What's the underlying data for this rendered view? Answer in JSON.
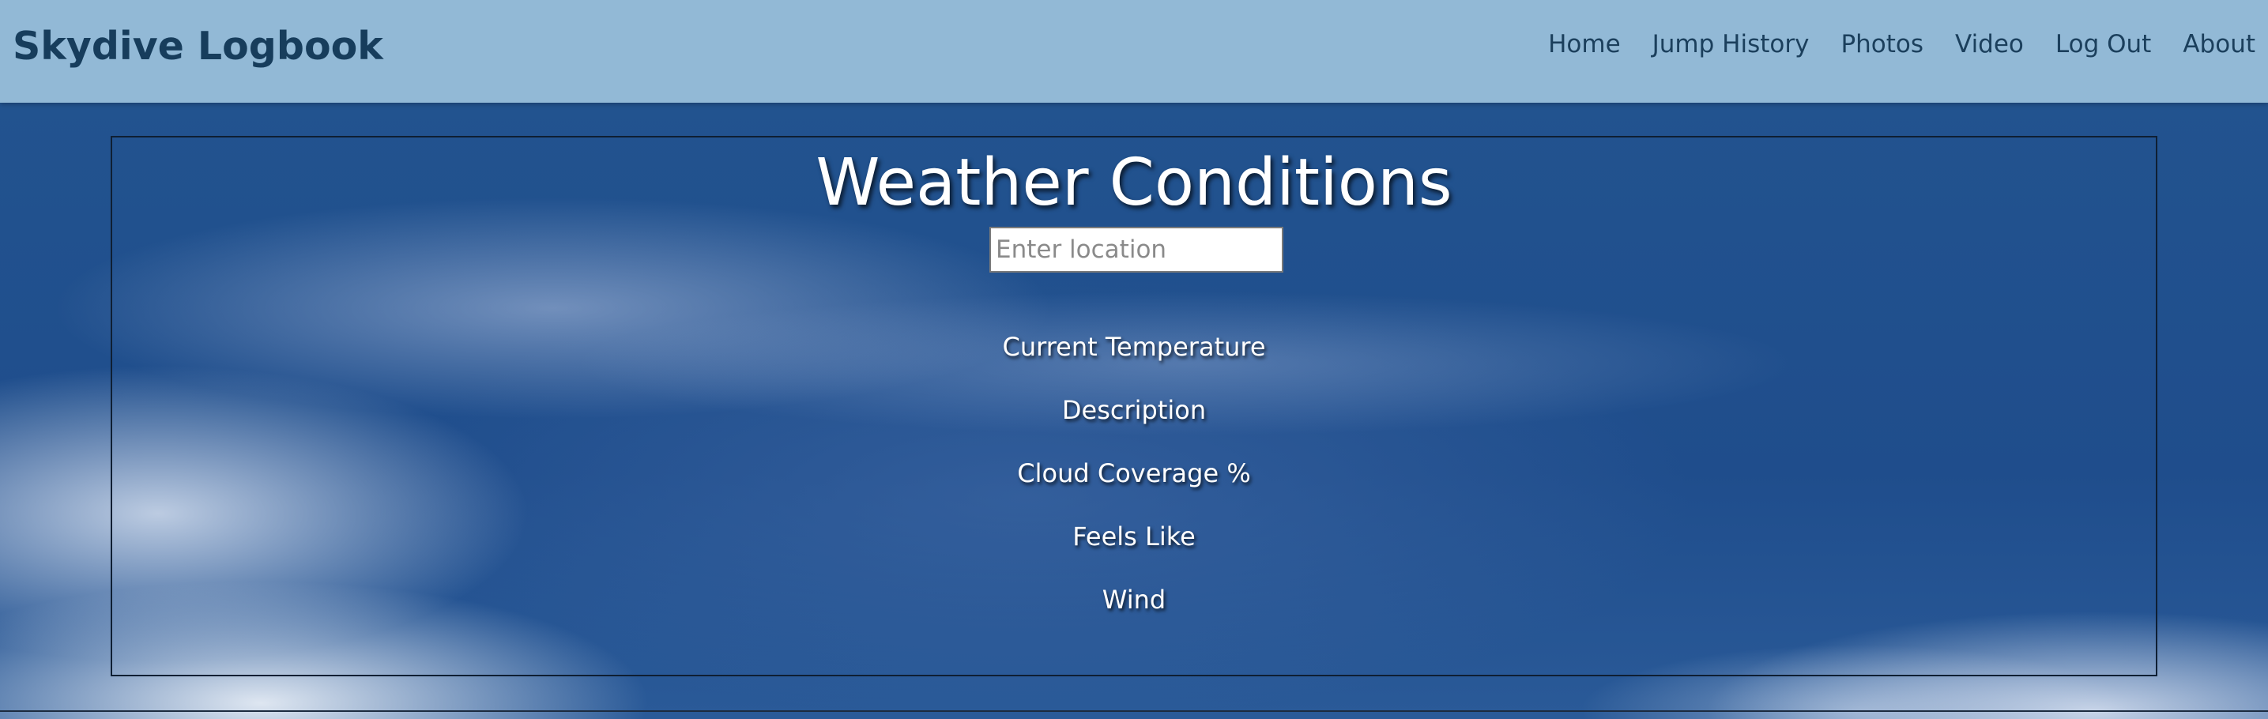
{
  "header": {
    "brand": "Skydive Logbook",
    "nav": [
      {
        "label": "Home"
      },
      {
        "label": "Jump History"
      },
      {
        "label": "Photos"
      },
      {
        "label": "Video"
      },
      {
        "label": "Log Out"
      },
      {
        "label": "About"
      }
    ]
  },
  "main": {
    "title": "Weather Conditions",
    "search": {
      "value": "",
      "placeholder": "Enter location"
    },
    "fields": [
      {
        "label": "Current Temperature"
      },
      {
        "label": "Description"
      },
      {
        "label": "Cloud Coverage %"
      },
      {
        "label": "Feels Like"
      },
      {
        "label": "Wind"
      }
    ]
  },
  "colors": {
    "header_bg": "#92b9d6",
    "brand_text": "#173d5c",
    "sky_blue": "#1f4f8f"
  }
}
